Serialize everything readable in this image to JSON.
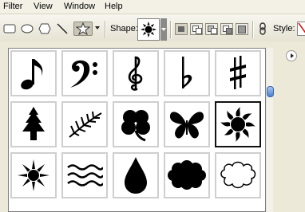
{
  "menu": {
    "items": [
      "Filter",
      "View",
      "Window",
      "Help"
    ]
  },
  "options_bar": {
    "shape_label": "Shape:",
    "style_label": "Style:",
    "tools": [
      "rectangle-tool",
      "rounded-rectangle-tool",
      "ellipse-tool",
      "polygon-tool",
      "line-tool",
      "custom-shape-tool"
    ],
    "selected_shape": "sun-icon"
  },
  "shapes_panel": {
    "rows": [
      [
        "eighth-note-icon",
        "bass-clef-icon",
        "treble-clef-icon",
        "flat-sign-icon",
        "sharp-sign-icon"
      ],
      [
        "tree-icon",
        "fern-leaf-icon",
        "four-leaf-clover-icon",
        "butterfly-icon",
        "sun-icon"
      ],
      [
        "star-burst-icon",
        "waves-icon",
        "raindrop-icon",
        "cloud-filled-icon",
        "cloud-outline-icon"
      ]
    ],
    "selected": "sun-icon"
  }
}
